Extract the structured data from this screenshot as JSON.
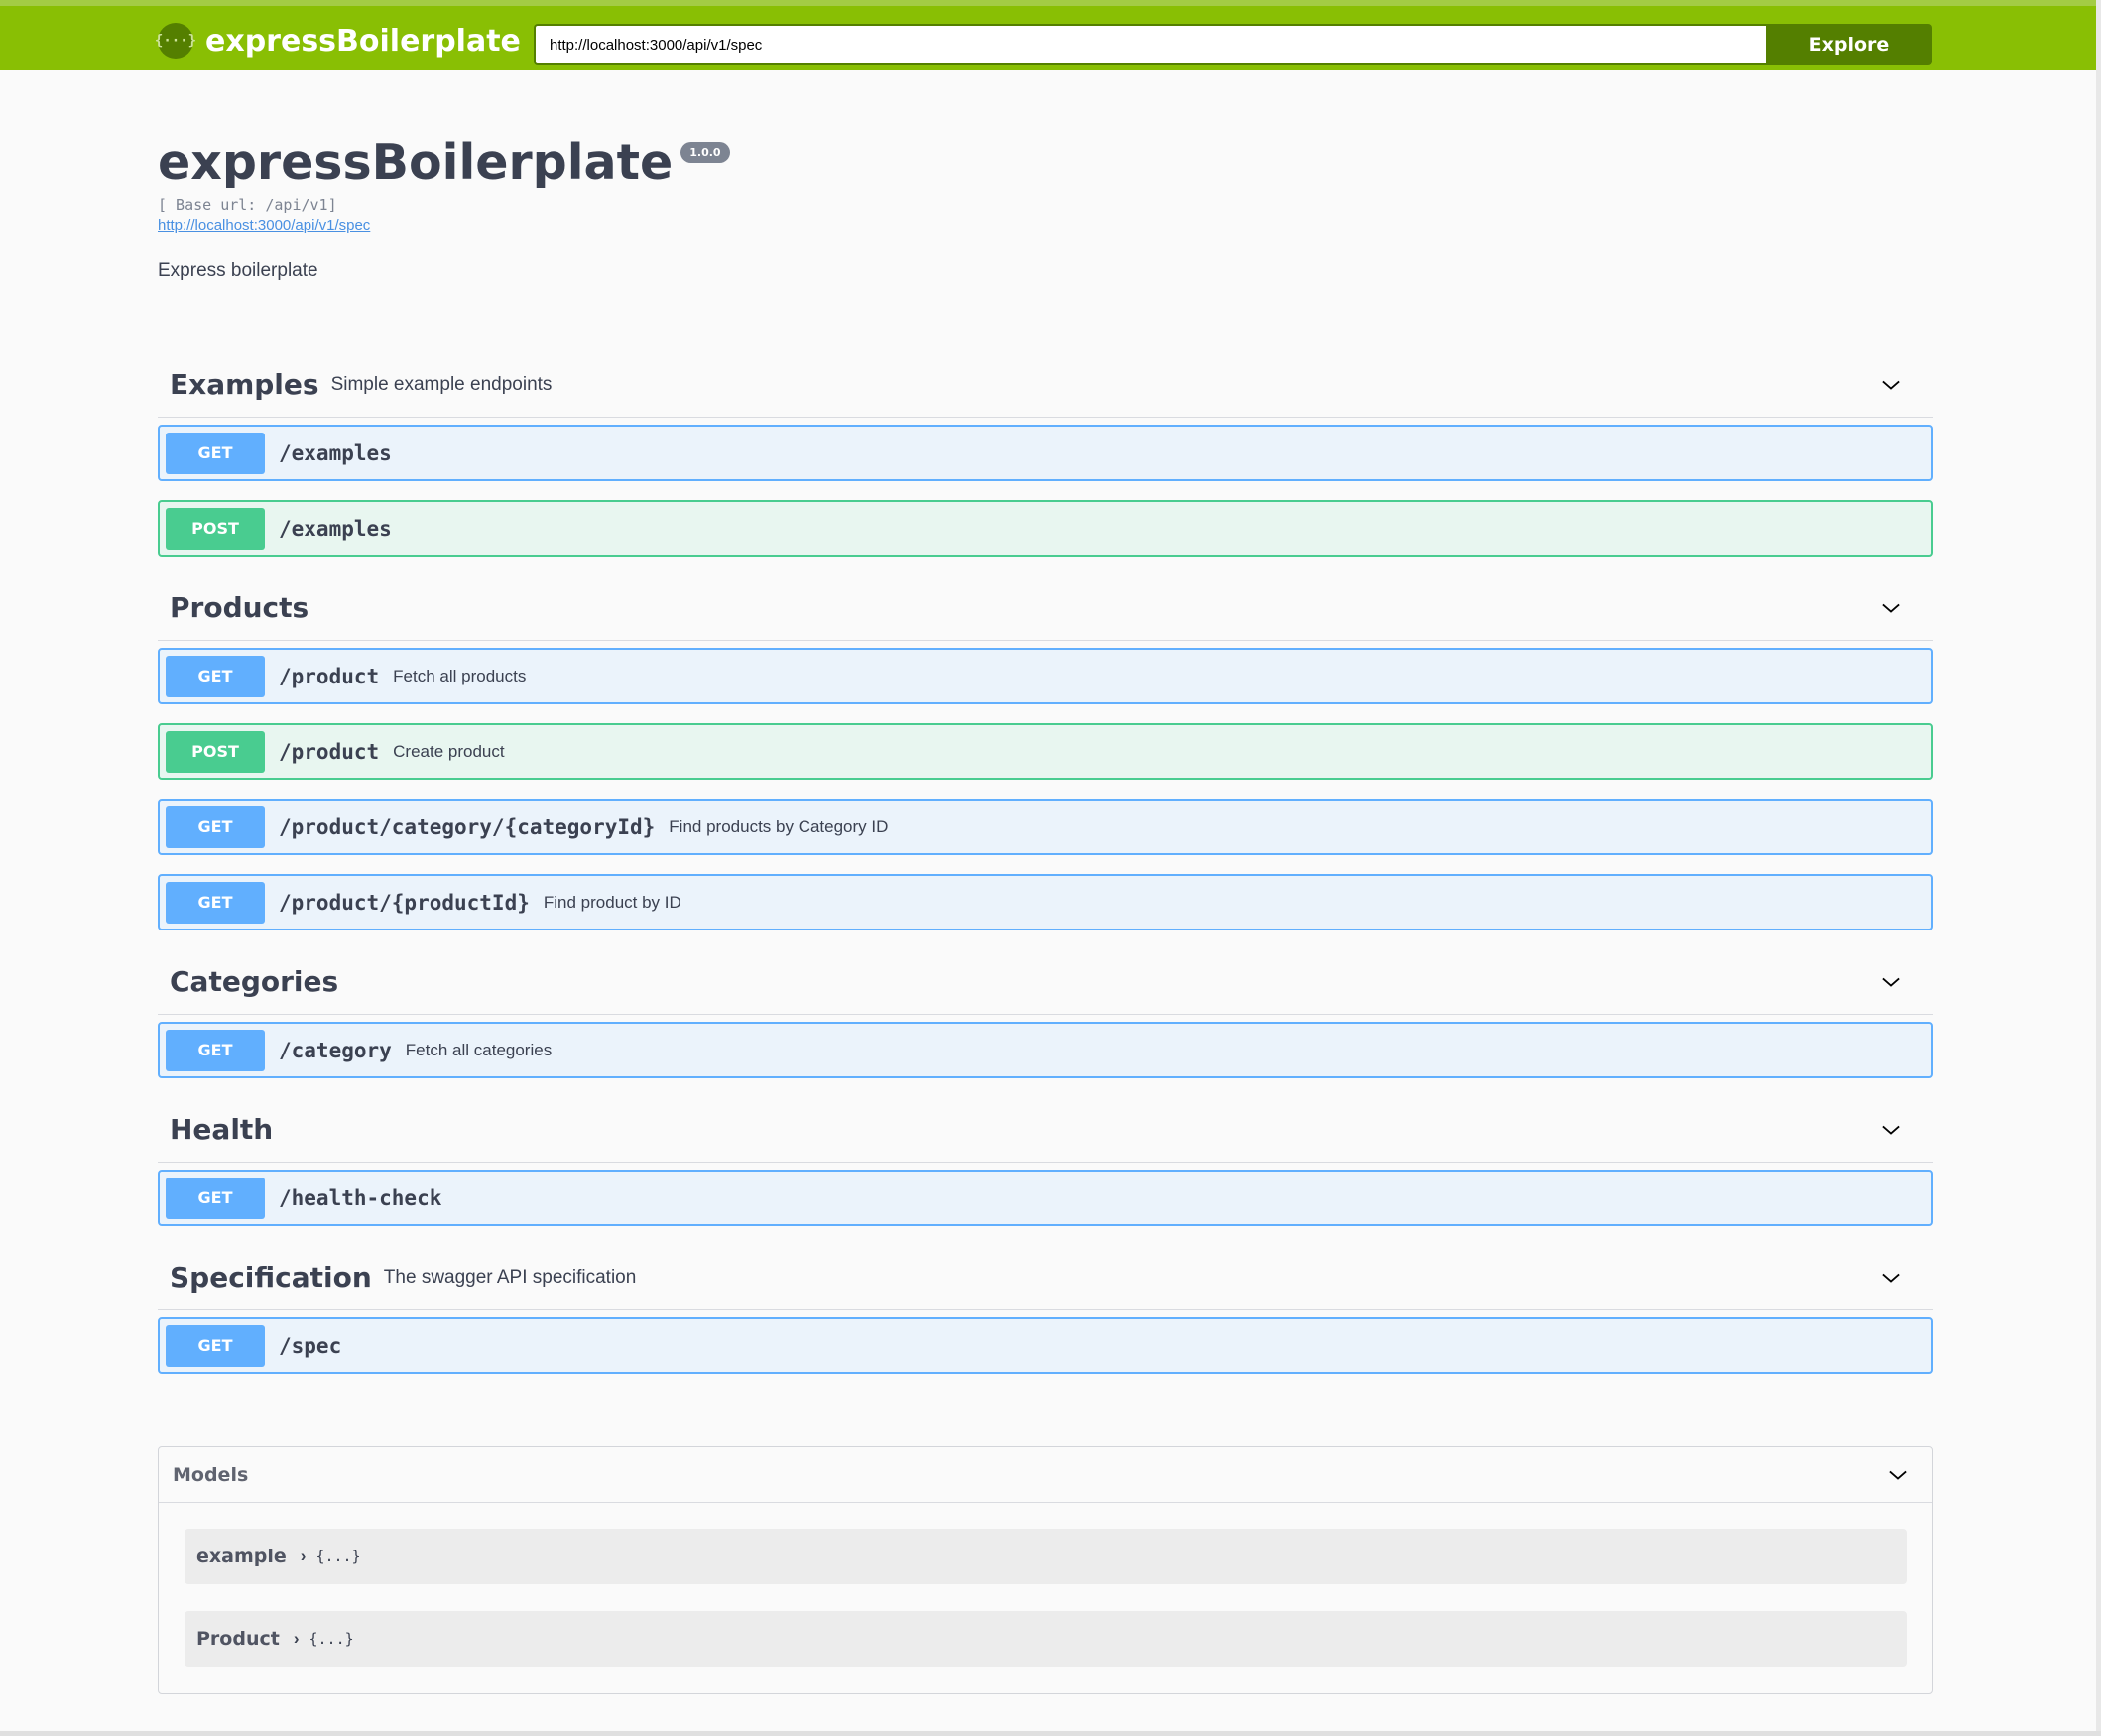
{
  "topbar": {
    "logo_glyph": "{···}",
    "logo_text": "expressBoilerplate",
    "url_value": "http://localhost:3000/api/v1/spec",
    "explore_label": "Explore",
    "color": "#89bf04"
  },
  "info": {
    "title": "expressBoilerplate",
    "version": "1.0.0",
    "base_url": "[ Base url: /api/v1]",
    "spec_link": "http://localhost:3000/api/v1/spec",
    "description": "Express boilerplate"
  },
  "tags": [
    {
      "name": "Examples",
      "description": "Simple example endpoints",
      "operations": [
        {
          "method": "GET",
          "path": "/examples",
          "summary": ""
        },
        {
          "method": "POST",
          "path": "/examples",
          "summary": ""
        }
      ]
    },
    {
      "name": "Products",
      "description": "",
      "operations": [
        {
          "method": "GET",
          "path": "/product",
          "summary": "Fetch all products"
        },
        {
          "method": "POST",
          "path": "/product",
          "summary": "Create product"
        },
        {
          "method": "GET",
          "path": "/product/category/{categoryId}",
          "summary": "Find products by Category ID"
        },
        {
          "method": "GET",
          "path": "/product/{productId}",
          "summary": "Find product by ID"
        }
      ]
    },
    {
      "name": "Categories",
      "description": "",
      "operations": [
        {
          "method": "GET",
          "path": "/category",
          "summary": "Fetch all categories"
        }
      ]
    },
    {
      "name": "Health",
      "description": "",
      "operations": [
        {
          "method": "GET",
          "path": "/health-check",
          "summary": ""
        }
      ]
    },
    {
      "name": "Specification",
      "description": "The swagger API specification",
      "operations": [
        {
          "method": "GET",
          "path": "/spec",
          "summary": ""
        }
      ]
    }
  ],
  "models": {
    "title": "Models",
    "items": [
      {
        "name": "example",
        "preview": "{...}"
      },
      {
        "name": "Product",
        "preview": "{...}"
      }
    ]
  }
}
